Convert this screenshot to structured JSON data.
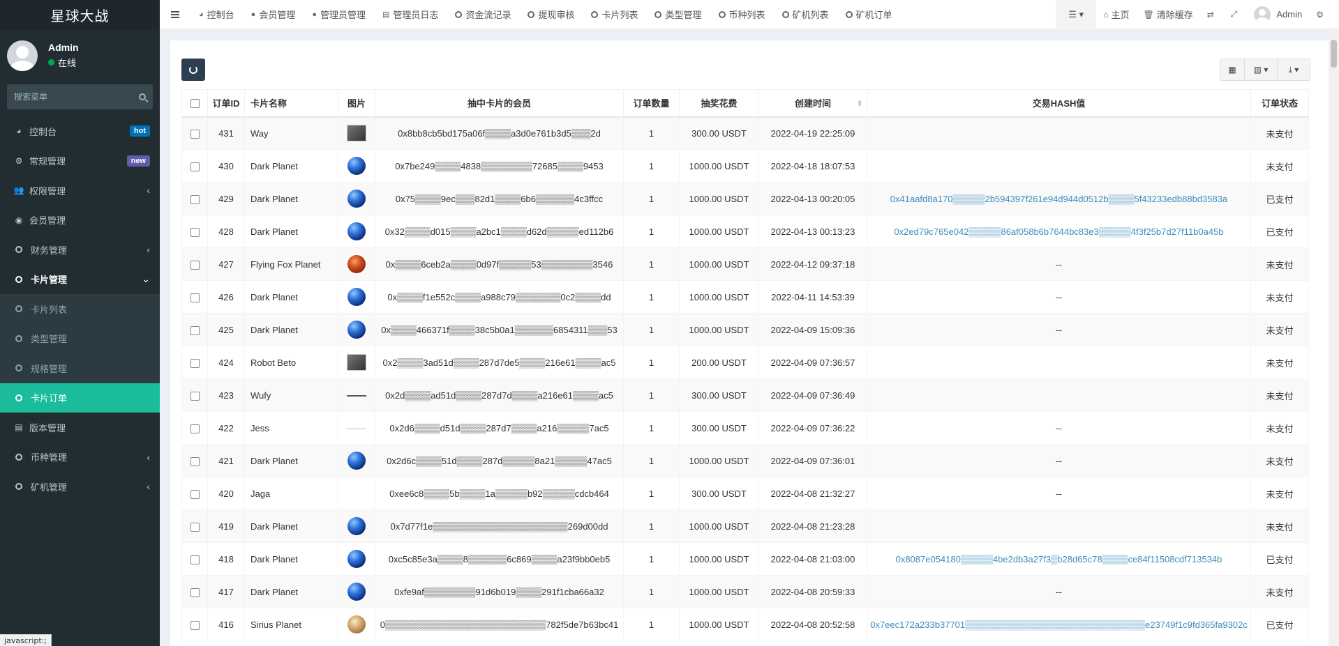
{
  "app": {
    "title": "星球大战"
  },
  "user": {
    "name": "Admin",
    "status": "在线"
  },
  "sidebar": {
    "search_placeholder": "搜索菜单",
    "items": [
      {
        "label": "控制台",
        "icon": "dashboard-icon",
        "badge": "hot",
        "badge_color": "#0073b7"
      },
      {
        "label": "常规管理",
        "icon": "cogs-icon",
        "badge": "new",
        "badge_color": "#605ca8"
      },
      {
        "label": "权限管理",
        "icon": "group-icon",
        "chevron": "‹"
      },
      {
        "label": "会员管理",
        "icon": "user-circle-icon"
      },
      {
        "label": "财务管理",
        "icon": "circle-icon",
        "chevron": "‹"
      },
      {
        "label": "卡片管理",
        "icon": "circle-icon",
        "chevron": "⌄"
      },
      {
        "label": "版本管理",
        "icon": "file-icon"
      },
      {
        "label": "币种管理",
        "icon": "circle-icon",
        "chevron": "‹"
      },
      {
        "label": "矿机管理",
        "icon": "circle-icon",
        "chevron": "‹"
      }
    ],
    "card_submenu": [
      {
        "label": "卡片列表"
      },
      {
        "label": "类型管理"
      },
      {
        "label": "规格管理"
      },
      {
        "label": "卡片订单"
      }
    ]
  },
  "nav": {
    "tabs": [
      "控制台",
      "会员管理",
      "管理员管理",
      "管理员日志",
      "资金流记录",
      "提现审核",
      "卡片列表",
      "类型管理",
      "币种列表",
      "矿机列表",
      "矿机订单"
    ],
    "home": "主页",
    "clear_cache": "清除缓存",
    "admin": "Admin"
  },
  "table": {
    "headers": [
      "订单ID",
      "卡片名称",
      "图片",
      "抽中卡片的会员",
      "订单数量",
      "抽奖花费",
      "创建时间",
      "交易HASH值",
      "订单状态"
    ],
    "rows": [
      {
        "id": "431",
        "name": "Way",
        "img": "thumb",
        "member": "0x8bb8cb5bd175a06f▒▒▒▒a3d0e761b3d5▒▒▒2d",
        "qty": "1",
        "cost": "300.00 USDT",
        "time": "2022-04-19 22:25:09",
        "hash": "",
        "status": "未支付"
      },
      {
        "id": "430",
        "name": "Dark Planet",
        "img": "planet",
        "member": "0x7be249▒▒▒▒4838▒▒▒▒▒▒▒▒72685▒▒▒▒9453",
        "qty": "1",
        "cost": "1000.00 USDT",
        "time": "2022-04-18 18:07:53",
        "hash": "",
        "status": "未支付"
      },
      {
        "id": "429",
        "name": "Dark Planet",
        "img": "planet",
        "member": "0x75▒▒▒▒9ec▒▒▒82d1▒▒▒▒6b6▒▒▒▒▒▒4c3ffcc",
        "qty": "1",
        "cost": "1000.00 USDT",
        "time": "2022-04-13 00:20:05",
        "hash": "0x41aafd8a170▒▒▒▒▒2b594397f261e94d944d0512b▒▒▒▒5f43233edb88bd3583a",
        "status": "已支付"
      },
      {
        "id": "428",
        "name": "Dark Planet",
        "img": "planet",
        "member": "0x32▒▒▒▒d015▒▒▒▒a2bc1▒▒▒▒d62d▒▒▒▒▒ed112b6",
        "qty": "1",
        "cost": "1000.00 USDT",
        "time": "2022-04-13 00:13:23",
        "hash": "0x2ed79c765e042▒▒▒▒▒86af058b6b7644bc83e3▒▒▒▒▒4f3f25b7d27f11b0a45b",
        "status": "已支付"
      },
      {
        "id": "427",
        "name": "Flying Fox Planet",
        "img": "fox",
        "member": "0x▒▒▒▒6ceb2a▒▒▒▒0d97f▒▒▒▒▒53▒▒▒▒▒▒▒▒3546",
        "qty": "1",
        "cost": "1000.00 USDT",
        "time": "2022-04-12 09:37:18",
        "hash": "--",
        "status": "未支付"
      },
      {
        "id": "426",
        "name": "Dark Planet",
        "img": "planet",
        "member": "0x▒▒▒▒f1e552c▒▒▒▒a988c79▒▒▒▒▒▒▒0c2▒▒▒▒dd",
        "qty": "1",
        "cost": "1000.00 USDT",
        "time": "2022-04-11 14:53:39",
        "hash": "--",
        "status": "未支付"
      },
      {
        "id": "425",
        "name": "Dark Planet",
        "img": "planet",
        "member": "0x▒▒▒▒466371f▒▒▒▒38c5b0a1▒▒▒▒▒▒6854311▒▒▒53",
        "qty": "1",
        "cost": "1000.00 USDT",
        "time": "2022-04-09 15:09:36",
        "hash": "--",
        "status": "未支付"
      },
      {
        "id": "424",
        "name": "Robot Beto",
        "img": "thumb",
        "member": "0x2▒▒▒▒3ad51d▒▒▒▒287d7de5▒▒▒▒216e61▒▒▒▒ac5",
        "qty": "1",
        "cost": "200.00 USDT",
        "time": "2022-04-09 07:36:57",
        "hash": "",
        "status": "未支付"
      },
      {
        "id": "423",
        "name": "Wufy",
        "img": "line",
        "member": "0x2d▒▒▒▒ad51d▒▒▒▒287d7d▒▒▒▒a216e61▒▒▒▒ac5",
        "qty": "1",
        "cost": "300.00 USDT",
        "time": "2022-04-09 07:36:49",
        "hash": "",
        "status": "未支付"
      },
      {
        "id": "422",
        "name": "Jess",
        "img": "line-light",
        "member": "0x2d6▒▒▒▒d51d▒▒▒▒287d7▒▒▒▒a216▒▒▒▒▒7ac5",
        "qty": "1",
        "cost": "300.00 USDT",
        "time": "2022-04-09 07:36:22",
        "hash": "--",
        "status": "未支付"
      },
      {
        "id": "421",
        "name": "Dark Planet",
        "img": "planet",
        "member": "0x2d6c▒▒▒▒51d▒▒▒▒287d▒▒▒▒▒8a21▒▒▒▒▒47ac5",
        "qty": "1",
        "cost": "1000.00 USDT",
        "time": "2022-04-09 07:36:01",
        "hash": "--",
        "status": "未支付"
      },
      {
        "id": "420",
        "name": "Jaga",
        "img": "",
        "member": "0xee6c8▒▒▒▒5b▒▒▒▒1a▒▒▒▒▒b92▒▒▒▒▒cdcb464",
        "qty": "1",
        "cost": "300.00 USDT",
        "time": "2022-04-08 21:32:27",
        "hash": "--",
        "status": "未支付"
      },
      {
        "id": "419",
        "name": "Dark Planet",
        "img": "planet",
        "member": "0x7d77f1e▒▒▒▒▒▒▒▒▒▒▒▒▒▒▒▒▒▒▒▒▒269d00dd",
        "qty": "1",
        "cost": "1000.00 USDT",
        "time": "2022-04-08 21:23:28",
        "hash": "",
        "status": "未支付"
      },
      {
        "id": "418",
        "name": "Dark Planet",
        "img": "planet",
        "member": "0xc5c85e3a▒▒▒▒8▒▒▒▒▒▒6c869▒▒▒▒a23f9bb0eb5",
        "qty": "1",
        "cost": "1000.00 USDT",
        "time": "2022-04-08 21:03:00",
        "hash": "0x8087e054180▒▒▒▒▒4be2db3a27f3▒b28d65c78▒▒▒▒ce84f11508cdf713534b",
        "status": "已支付"
      },
      {
        "id": "417",
        "name": "Dark Planet",
        "img": "planet",
        "member": "0xfe9af▒▒▒▒▒▒▒▒91d6b019▒▒▒▒291f1cba66a32",
        "qty": "1",
        "cost": "1000.00 USDT",
        "time": "2022-04-08 20:59:33",
        "hash": "--",
        "status": "未支付"
      },
      {
        "id": "416",
        "name": "Sirius Planet",
        "img": "sirius",
        "member": "0▒▒▒▒▒▒▒▒▒▒▒▒▒▒▒▒▒▒▒▒▒▒▒▒▒782f5de7b63bc41",
        "qty": "1",
        "cost": "1000.00 USDT",
        "time": "2022-04-08 20:52:58",
        "hash": "0x7eec172a233b37701▒▒▒▒▒▒▒▒▒▒▒▒▒▒▒▒▒▒▒▒▒▒▒▒▒▒▒▒e23749f1c9fd365fa9302c",
        "status": "已支付"
      }
    ]
  },
  "statusbar": {
    "text": "javascript:;"
  },
  "colors": {
    "sidebar": "#222d32",
    "active": "#1abc9c",
    "link": "#3c8dbc"
  }
}
